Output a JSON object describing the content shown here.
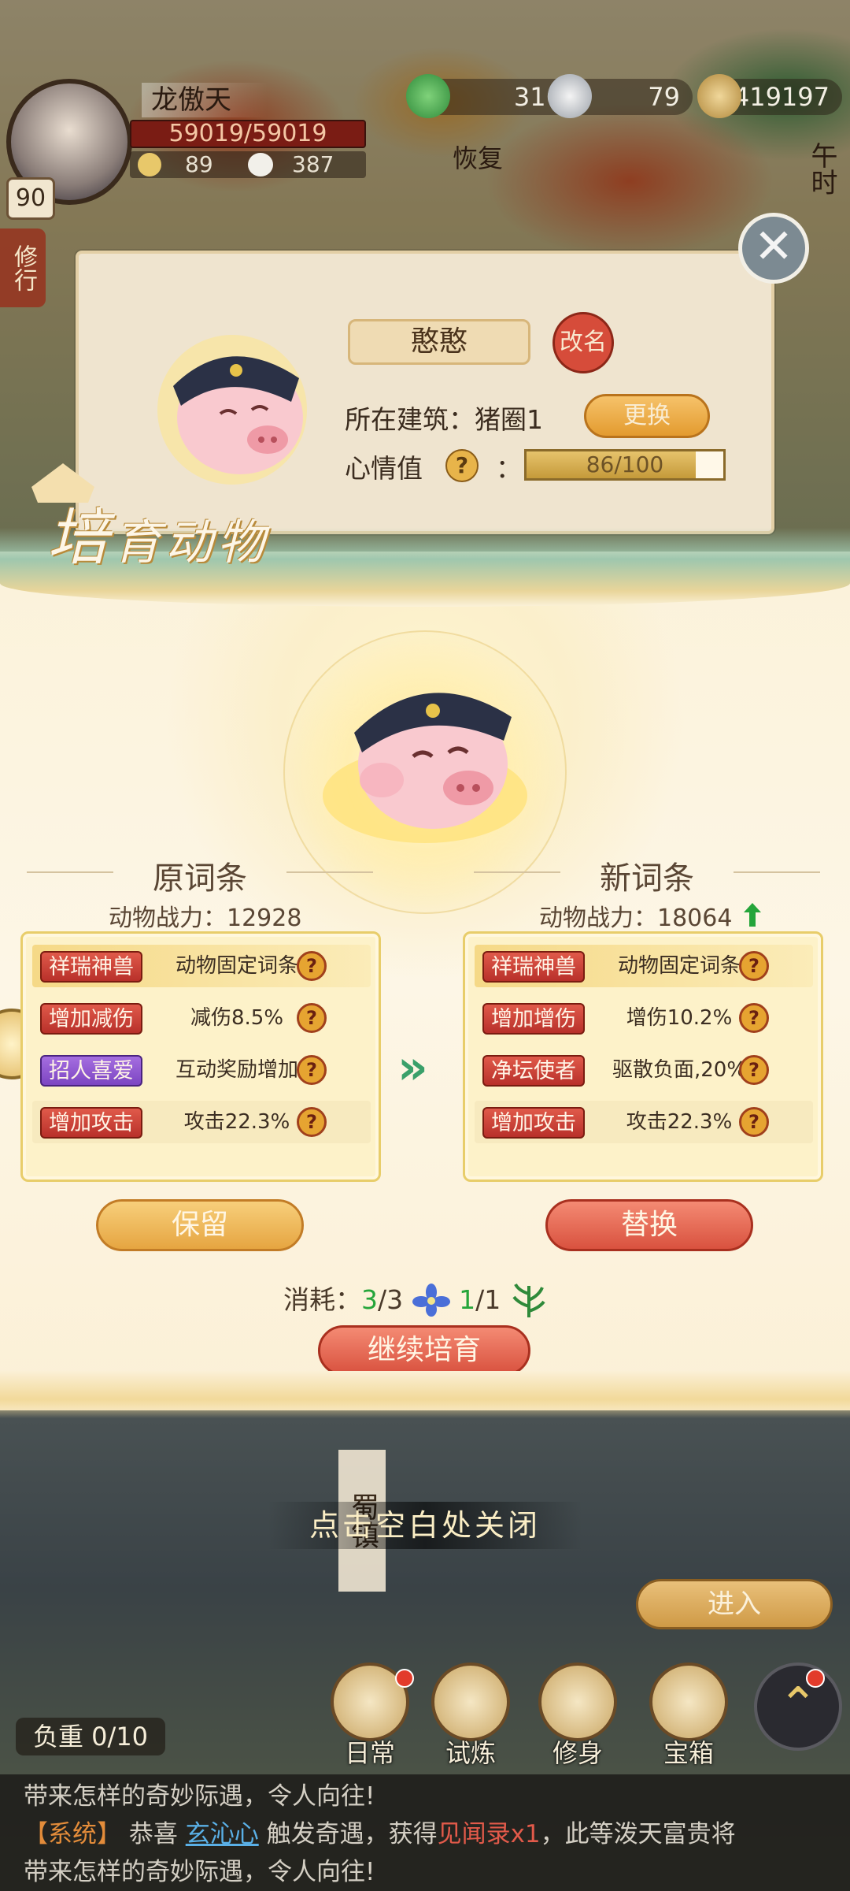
{
  "player": {
    "name": "龙傲天",
    "level": "90",
    "hp": "59019/59019",
    "stat_a": "89",
    "stat_b": "387"
  },
  "currencies": [
    {
      "icon": "jade-dragon-icon",
      "value": "316"
    },
    {
      "icon": "silver-ingot-icon",
      "value": "79"
    },
    {
      "icon": "coin-pile-icon",
      "value": "419197"
    }
  ],
  "hud": {
    "recover_label": "恢复",
    "side_button": "修行",
    "time_label": "午时"
  },
  "pet_info": {
    "name": "憨憨",
    "rename_label": "改名",
    "building_label": "所在建筑：猪圈1",
    "swap_label": "更换",
    "mood_label": "心情值",
    "mood_help": "?",
    "mood_colon": "：",
    "mood_value": "86/100",
    "mood_ratio": 0.86
  },
  "breed": {
    "title_big": "培",
    "title_rest": "育动物",
    "old_title": "原词条",
    "new_title": "新词条",
    "old_power": "动物战力：12928",
    "new_power": "动物战力：18064",
    "old_traits": [
      {
        "tag": "祥瑞神兽",
        "desc": "动物固定词条",
        "color": "red"
      },
      {
        "tag": "增加减伤",
        "desc": "减伤8.5%",
        "color": "red"
      },
      {
        "tag": "招人喜爱",
        "desc": "互动奖励增加",
        "color": "purple"
      },
      {
        "tag": "增加攻击",
        "desc": "攻击22.3%",
        "color": "red"
      }
    ],
    "new_traits": [
      {
        "tag": "祥瑞神兽",
        "desc": "动物固定词条",
        "color": "red"
      },
      {
        "tag": "增加增伤",
        "desc": "增伤10.2%",
        "color": "red"
      },
      {
        "tag": "净坛使者",
        "desc": "驱散负面,20%",
        "color": "red"
      },
      {
        "tag": "增加攻击",
        "desc": "攻击22.3%",
        "color": "red"
      }
    ],
    "help_glyph": "?",
    "keep_label": "保留",
    "replace_label": "替换",
    "cost_label": "消耗：",
    "cost_a_have": "3",
    "cost_a_need": "/3",
    "cost_b_have": "1",
    "cost_b_need": "/1",
    "continue_label": "继续培育"
  },
  "bottom": {
    "tap_close": "点击空白处关闭",
    "town_sign": "蜀镇",
    "enter_label": "进入",
    "load_label": "负重 0/10",
    "nav": [
      {
        "label": "日常",
        "icon": "scroll-icon"
      },
      {
        "label": "试炼",
        "icon": "sword-icon"
      },
      {
        "label": "修身",
        "icon": "brush-icon"
      },
      {
        "label": "宝箱",
        "icon": "treasure-chest-icon"
      }
    ]
  },
  "chat": {
    "line1": "带来怎样的奇妙际遇，令人向往!",
    "sys_tag": "【系统】",
    "congrats": " 恭喜 ",
    "user": "玄沁心",
    "trigger": " 触发奇遇，获得",
    "item": "见闻录x1",
    "tail": "，此等泼天富贵将",
    "line3": "带来怎样的奇妙际遇，令人向往!"
  },
  "colors": {
    "accent_red": "#d9523f",
    "accent_gold": "#e6a541",
    "up_green": "#25a53a"
  }
}
